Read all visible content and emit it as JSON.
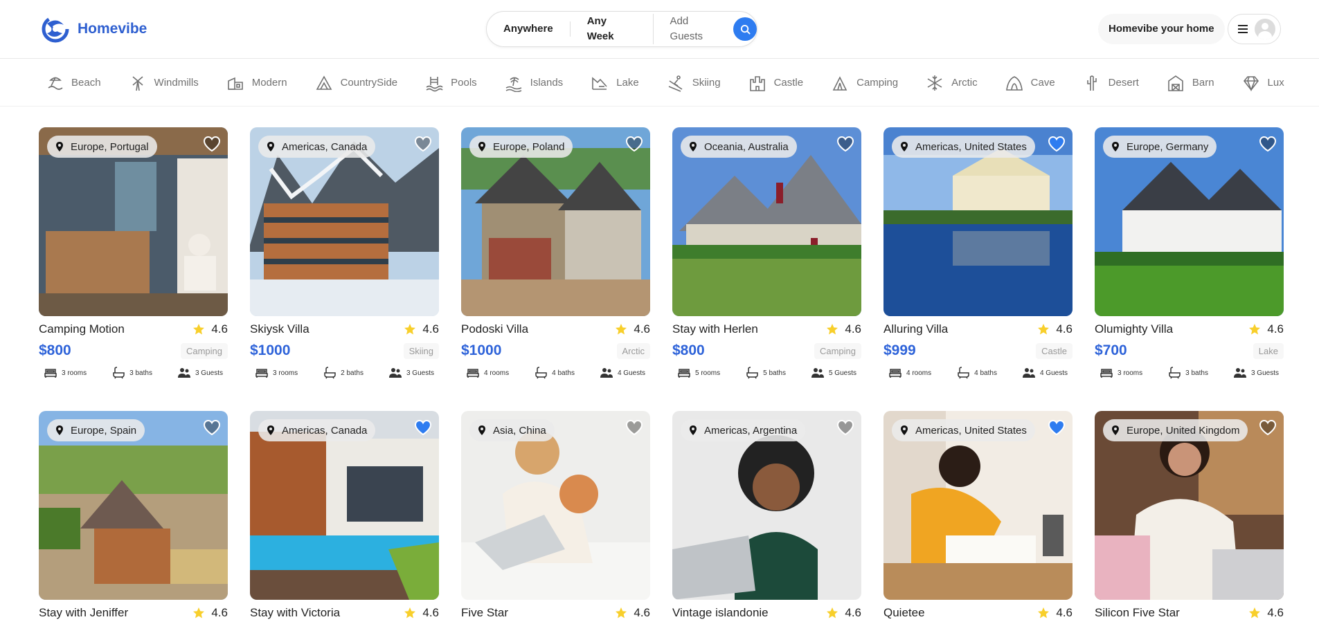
{
  "header": {
    "logo_text": "Homevibe",
    "search": {
      "location": "Anywhere",
      "week": "Any Week",
      "guests": "Add Guests"
    },
    "host_button": "Homevibe your home"
  },
  "categories": [
    "Beach",
    "Windmills",
    "Modern",
    "CountrySide",
    "Pools",
    "Islands",
    "Lake",
    "Skiing",
    "Castle",
    "Camping",
    "Arctic",
    "Cave",
    "Desert",
    "Barn",
    "Lux"
  ],
  "colors": {
    "brand": "#2e5fd0",
    "price": "#2e63d9",
    "favorite": "#2e7cf0",
    "star": "#f8cf2b"
  },
  "listings": [
    {
      "location": "Europe, Portugal",
      "title": "Camping Motion",
      "rating": "4.6",
      "price": "$800",
      "tag": "Camping",
      "rooms": "3 rooms",
      "baths": "3 baths",
      "guests": "3 Guests",
      "favorite": false
    },
    {
      "location": "Americas, Canada",
      "title": "Skiysk Villa",
      "rating": "4.6",
      "price": "$1000",
      "tag": "Skiing",
      "rooms": "3 rooms",
      "baths": "2 baths",
      "guests": "3 Guests",
      "favorite": false
    },
    {
      "location": "Europe, Poland",
      "title": "Podoski Villa",
      "rating": "4.6",
      "price": "$1000",
      "tag": "Arctic",
      "rooms": "4 rooms",
      "baths": "4 baths",
      "guests": "4 Guests",
      "favorite": false
    },
    {
      "location": "Oceania, Australia",
      "title": "Stay with Herlen",
      "rating": "4.6",
      "price": "$800",
      "tag": "Camping",
      "rooms": "5 rooms",
      "baths": "5 baths",
      "guests": "5 Guests",
      "favorite": false
    },
    {
      "location": "Americas, United States",
      "title": "Alluring Villa",
      "rating": "4.6",
      "price": "$999",
      "tag": "Castle",
      "rooms": "4 rooms",
      "baths": "4 baths",
      "guests": "4 Guests",
      "favorite": true
    },
    {
      "location": "Europe, Germany",
      "title": "Olumighty Villa",
      "rating": "4.6",
      "price": "$700",
      "tag": "Lake",
      "rooms": "3 rooms",
      "baths": "3 baths",
      "guests": "3 Guests",
      "favorite": false
    },
    {
      "location": "Europe, Spain",
      "title": "Stay with Jeniffer",
      "rating": "4.6",
      "favorite": false
    },
    {
      "location": "Americas, Canada",
      "title": "Stay with Victoria",
      "rating": "4.6",
      "favorite": true
    },
    {
      "location": "Asia, China",
      "title": "Five Star",
      "rating": "4.6",
      "favorite": false
    },
    {
      "location": "Americas, Argentina",
      "title": "Vintage islandonie",
      "rating": "4.6",
      "favorite": false
    },
    {
      "location": "Americas, United States",
      "title": "Quietee",
      "rating": "4.6",
      "favorite": true
    },
    {
      "location": "Europe, United Kingdom",
      "title": "Silicon Five Star",
      "rating": "4.6",
      "favorite": false
    }
  ]
}
